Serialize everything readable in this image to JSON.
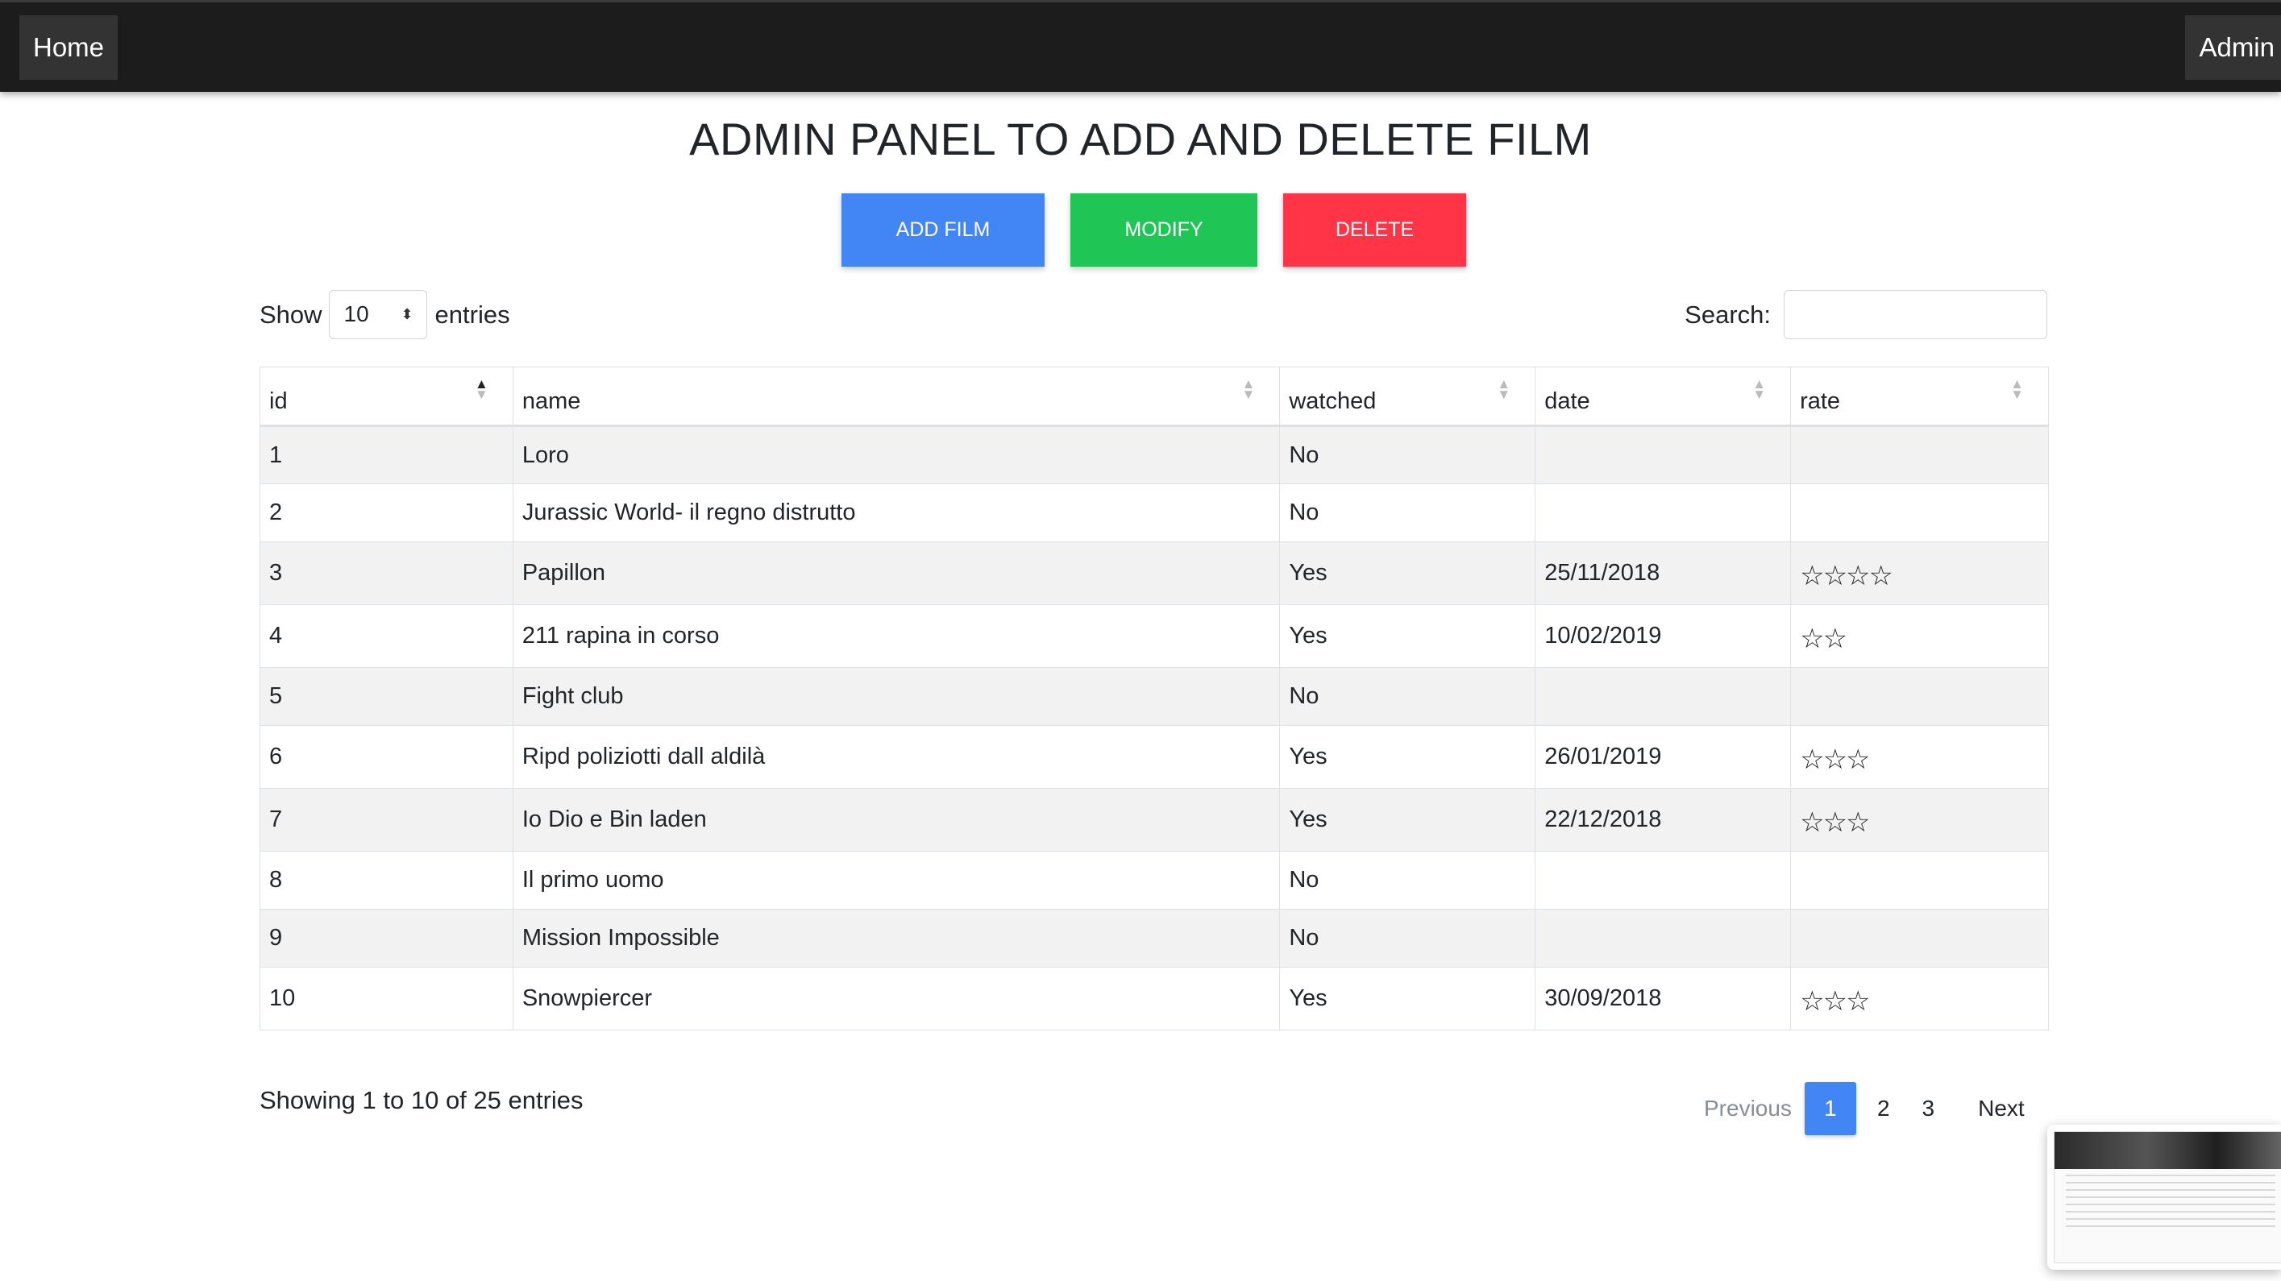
{
  "nav": {
    "home": "Home",
    "admin": "Admin"
  },
  "title": "ADMIN PANEL TO ADD AND DELETE FILM",
  "buttons": {
    "add": "ADD FILM",
    "modify": "MODIFY",
    "delete": "DELETE"
  },
  "length": {
    "show": "Show",
    "value": "10",
    "entries": "entries"
  },
  "search": {
    "label": "Search:",
    "value": ""
  },
  "table": {
    "columns": [
      "id",
      "name",
      "watched",
      "date",
      "rate"
    ],
    "rows": [
      {
        "id": "1",
        "name": "Loro",
        "watched": "No",
        "date": "",
        "rate": ""
      },
      {
        "id": "2",
        "name": "Jurassic World- il regno distrutto",
        "watched": "No",
        "date": "",
        "rate": ""
      },
      {
        "id": "3",
        "name": "Papillon",
        "watched": "Yes",
        "date": "25/11/2018",
        "rate": "☆☆☆☆"
      },
      {
        "id": "4",
        "name": "211 rapina in corso",
        "watched": "Yes",
        "date": "10/02/2019",
        "rate": "☆☆"
      },
      {
        "id": "5",
        "name": "Fight club",
        "watched": "No",
        "date": "",
        "rate": ""
      },
      {
        "id": "6",
        "name": "Ripd poliziotti dall aldilà",
        "watched": "Yes",
        "date": "26/01/2019",
        "rate": "☆☆☆"
      },
      {
        "id": "7",
        "name": "Io Dio e Bin laden",
        "watched": "Yes",
        "date": "22/12/2018",
        "rate": "☆☆☆"
      },
      {
        "id": "8",
        "name": "Il primo uomo",
        "watched": "No",
        "date": "",
        "rate": ""
      },
      {
        "id": "9",
        "name": "Mission Impossible",
        "watched": "No",
        "date": "",
        "rate": ""
      },
      {
        "id": "10",
        "name": "Snowpiercer",
        "watched": "Yes",
        "date": "30/09/2018",
        "rate": "☆☆☆"
      }
    ]
  },
  "info": "Showing 1 to 10 of 25 entries",
  "pagination": {
    "previous": "Previous",
    "pages": [
      "1",
      "2",
      "3"
    ],
    "current": "1",
    "next": "Next"
  },
  "colors": {
    "add": "#4285f4",
    "modify": "#1fc656",
    "delete": "#ff3547",
    "navbar": "#1c1c1c"
  }
}
